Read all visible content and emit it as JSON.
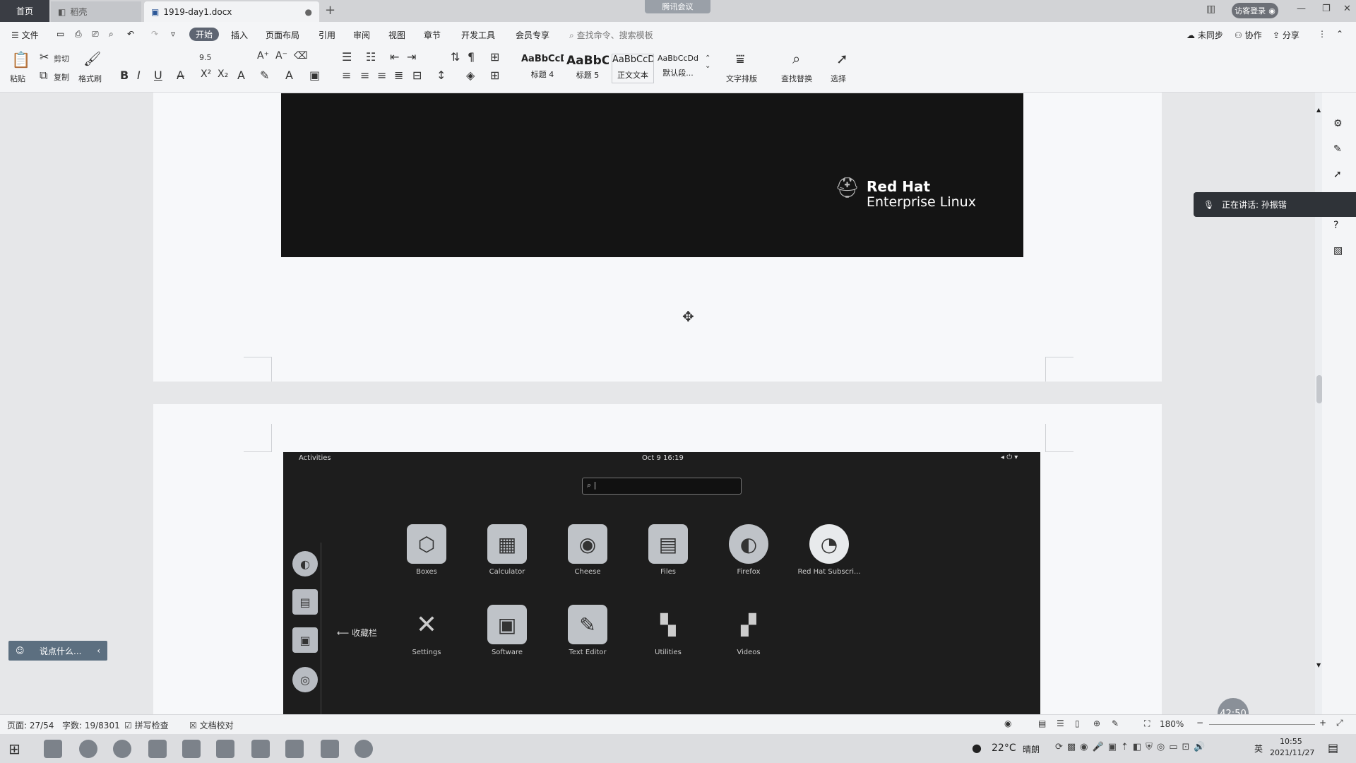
{
  "tabs": {
    "home": "首页",
    "daoke": "稻壳",
    "doc": "1919-day1.docx",
    "new": "+"
  },
  "meeting_label": "腾讯会议",
  "login_label": "访客登录",
  "menu": {
    "file": "文件",
    "items": [
      "开始",
      "插入",
      "页面布局",
      "引用",
      "审阅",
      "视图",
      "章节",
      "开发工具",
      "会员专享"
    ],
    "search_placeholder": "查找命令、搜索模板",
    "sync": "未同步",
    "collab": "协作",
    "share": "分享"
  },
  "ribbon": {
    "paste": "粘贴",
    "cut": "剪切",
    "copy": "复制",
    "format_painter": "格式刷",
    "font_size": "9.5",
    "styles": [
      {
        "sample": "AaBbCcD",
        "label": "标题 4"
      },
      {
        "sample": "AaBbC",
        "label": "标题 5"
      },
      {
        "sample": "AaBbCcDc",
        "label": "正文文本"
      },
      {
        "sample": "AaBbCcDd",
        "label": "默认段..."
      }
    ],
    "text_layout": "文字排版",
    "find_replace": "查找替换",
    "select": "选择"
  },
  "doc": {
    "redhat_line1": "Red Hat",
    "redhat_line2": "Enterprise Linux",
    "gnome": {
      "activities": "Activities",
      "clock": "Oct 9  16:19",
      "search_text": "|",
      "apps": [
        {
          "name": "Boxes",
          "icon": "cube-icon"
        },
        {
          "name": "Calculator",
          "icon": "calculator-icon"
        },
        {
          "name": "Cheese",
          "icon": "camera-icon"
        },
        {
          "name": "Files",
          "icon": "cabinet-icon"
        },
        {
          "name": "Firefox",
          "icon": "firefox-icon"
        },
        {
          "name": "Red Hat Subscri...",
          "icon": "subscription-icon"
        },
        {
          "name": "Settings",
          "icon": "tools-icon"
        },
        {
          "name": "Software",
          "icon": "bag-icon"
        },
        {
          "name": "Text Editor",
          "icon": "notepad-icon"
        },
        {
          "name": "Utilities",
          "icon": "folder-icon"
        },
        {
          "name": "Videos",
          "icon": "film-icon"
        }
      ],
      "favorites_label": "收藏栏"
    }
  },
  "speaking": "正在讲话: 孙振锴",
  "comment_placeholder": "说点什么...",
  "status": {
    "page": "页面: 27/54",
    "words": "字数: 19/8301",
    "spell": "拼写检查",
    "proof": "文档校对",
    "zoom": "180%"
  },
  "timer": "42:50",
  "tray": {
    "temp": "22°C",
    "weather": "晴朗",
    "ime": "英",
    "time": "10:55",
    "date": "2021/11/27"
  }
}
